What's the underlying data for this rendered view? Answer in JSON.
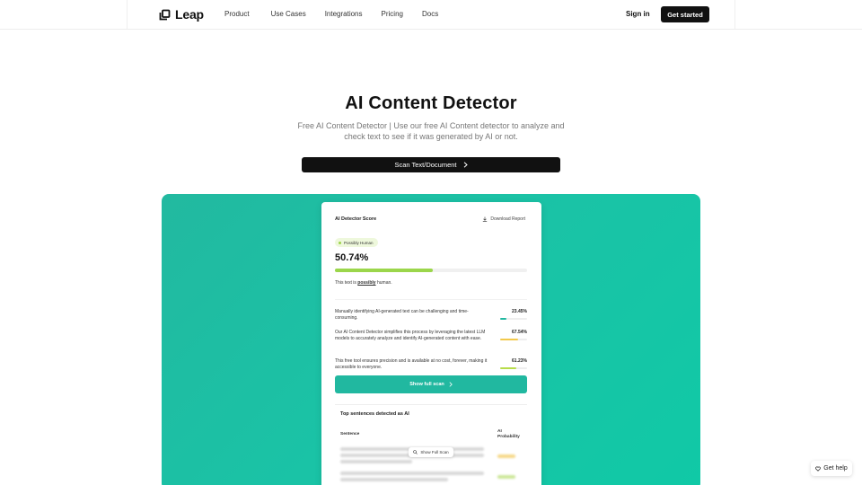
{
  "nav": {
    "logo_text": "Leap",
    "links": [
      "Product",
      "Use Cases",
      "Integrations",
      "Pricing",
      "Docs"
    ],
    "signin": "Sign in",
    "get_started": "Get started"
  },
  "hero": {
    "title": "AI Content Detector",
    "subtitle": "Free AI Content Detector | Use our free AI Content detector to analyze and check text to see if it was generated by AI or not.",
    "scan_button": "Scan Text/Document"
  },
  "card": {
    "title": "AI Detector Score",
    "download": "Download Report",
    "badge": "Possibly Human",
    "score": "50.74%",
    "score_fraction": 0.5074,
    "verdict_prefix": "This text is ",
    "verdict_word": "possibly",
    "verdict_suffix": " human.",
    "sentences": [
      {
        "text": "Manually identifying AI-generated text can be challenging and time-consuming.",
        "pct": "23.45%",
        "fraction": 0.2345,
        "color": "#21b8a0"
      },
      {
        "text": "Our AI Content Detector simplifies this process by leveraging the latest LLM models to accurately analyze and identify AI-generated content with ease.",
        "pct": "67.54%",
        "fraction": 0.6754,
        "color": "#f2c94c"
      },
      {
        "text": "This free tool ensures precision and is available at no cost, forever, making it accessible to everyone.",
        "pct": "61.23%",
        "fraction": 0.6123,
        "color": "#b7dc4a"
      }
    ],
    "full_scan": "Show full scan",
    "top_title": "Top sentences detected as AI",
    "col_sentence": "Sentence",
    "col_ai_1": "AI",
    "col_ai_2": "Probability",
    "show_full_scan": "Show Full Scan"
  },
  "help": "Get help",
  "colors": {
    "accent": "#21b8a0",
    "score_bar": "#9bd64b",
    "dark": "#111111"
  }
}
